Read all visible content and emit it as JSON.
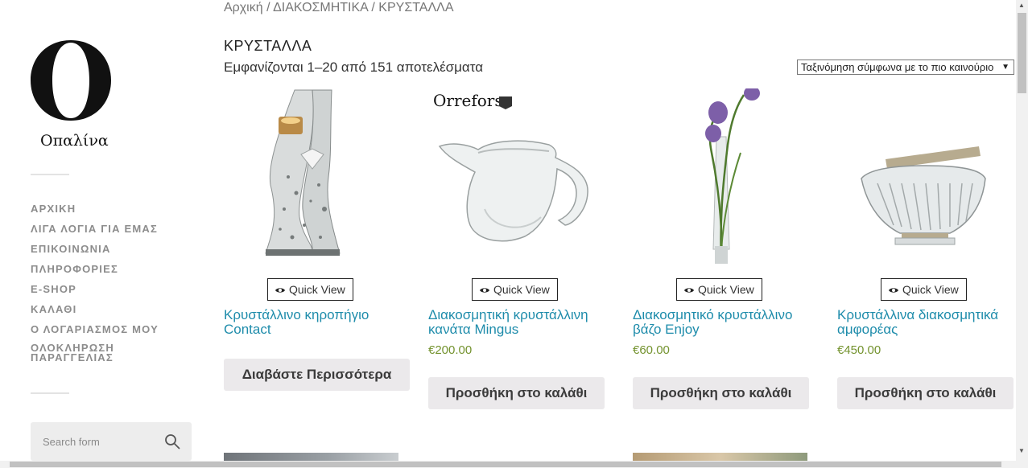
{
  "breadcrumb": "Αρχική / ΔΙΑΚΟΣΜΗΤΙΚΑ / ΚΡΥΣΤΑΛΛΑ",
  "logo": {
    "text": "Οπαλίνα",
    "icon": "logo-o-mark"
  },
  "nav": [
    "ΑΡΧΙΚΗ",
    "ΛΙΓΑ ΛΟΓΙΑ ΓΙΑ ΕΜΑΣ",
    "ΕΠΙΚΟΙΝΩΝΙΑ",
    "ΠΛΗΡΟΦΟΡΙΕΣ",
    "E-SHOP",
    "ΚΑΛΑΘΙ",
    "Ο ΛΟΓΑΡΙΑΣΜΟΣ ΜΟΥ",
    "ΟΛΟΚΛΗΡΩΣΗ ΠΑΡΑΓΓΕΛΙΑΣ"
  ],
  "search": {
    "placeholder": "Search form",
    "icon": "search-icon"
  },
  "page_title": "ΚΡΥΣΤΑΛΛΑ",
  "results_text": "Εμφανίζονται 1–20 από 151 αποτελέσματα",
  "sort": {
    "selected": "Ταξινόμηση σύμφωνα με το πιο καινούριο"
  },
  "quick_view_label": "Quick View",
  "products": [
    {
      "name": "Κρυστάλλινο κηροπήγιο Contact",
      "price": "",
      "button": "Διαβάστε Περισσότερα"
    },
    {
      "name": "Διακοσμητική κρυστάλλινη κανάτα Mingus",
      "price": "€200.00",
      "button": "Προσθήκη στο καλάθι",
      "brand": "Orrefors"
    },
    {
      "name": "Διακοσμητικό κρυστάλλινο βάζο Enjoy",
      "price": "€60.00",
      "button": "Προσθήκη στο καλάθι"
    },
    {
      "name": "Κρυστάλλινα διακοσμητικά αμφορέας",
      "price": "€450.00",
      "button": "Προσθήκη στο καλάθι"
    }
  ],
  "colors": {
    "link": "#1e8cab",
    "price": "#74932f",
    "button_bg": "#ebe9eb"
  }
}
